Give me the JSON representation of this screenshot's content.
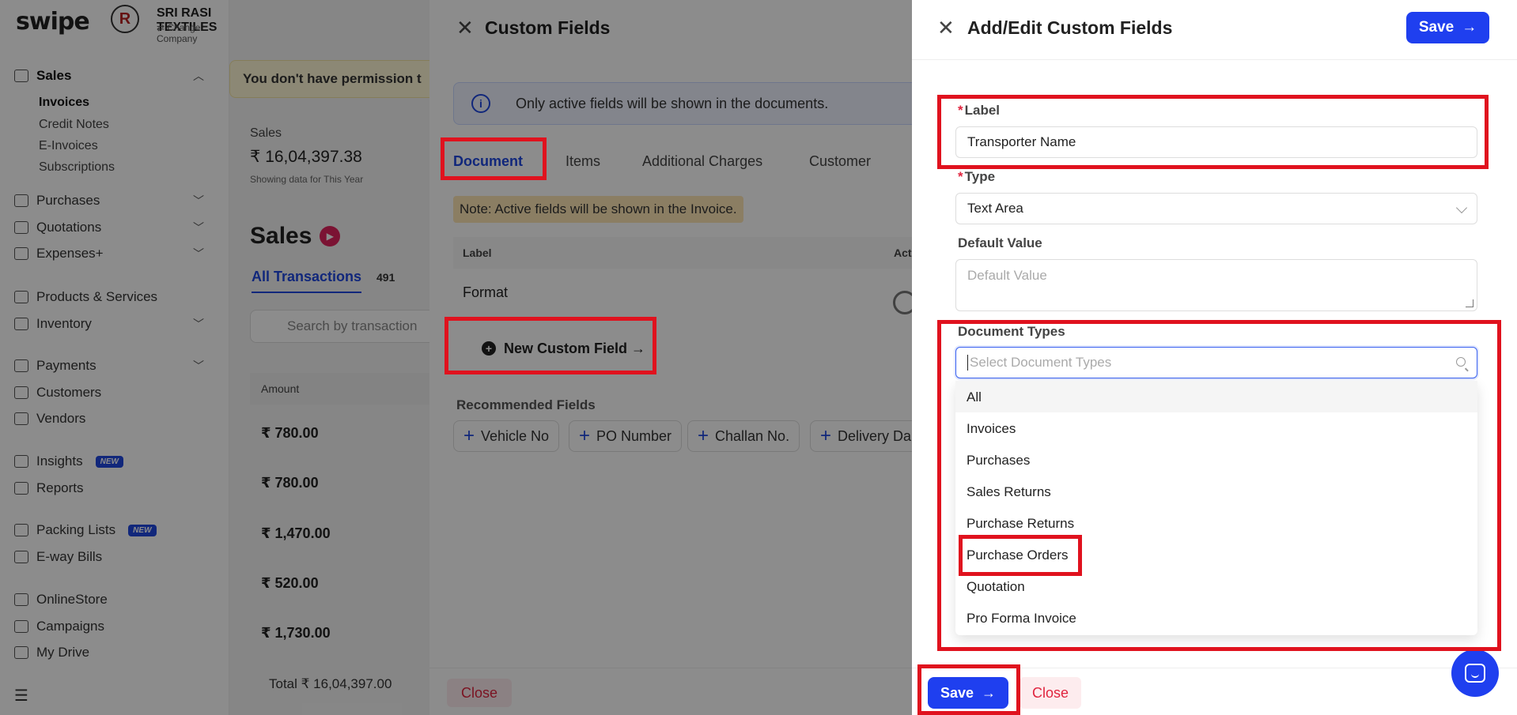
{
  "base": {
    "logo": "swipe",
    "company": {
      "name": "SRI RASI TEXTILES",
      "change": "Change Company",
      "logo_letter": "R"
    },
    "nav": {
      "sales": "Sales",
      "sales_sub": [
        "Invoices",
        "Credit Notes",
        "E-Invoices",
        "Subscriptions"
      ],
      "purchases": "Purchases",
      "quotations": "Quotations",
      "expenses": "Expenses+",
      "products": "Products & Services",
      "inventory": "Inventory",
      "payments": "Payments",
      "customers": "Customers",
      "vendors": "Vendors",
      "insights": "Insights",
      "reports": "Reports",
      "packing": "Packing Lists",
      "eway": "E-way Bills",
      "store": "OnlineStore",
      "campaigns": "Campaigns",
      "drive": "My Drive",
      "new_badge": "NEW"
    },
    "permission_banner": "You don't have permission t",
    "stat": {
      "label": "Sales",
      "value": "₹ 16,04,397.38",
      "note": "Showing data for This Year"
    },
    "page_title": "Sales",
    "tab_all": "All Transactions",
    "tab_count": "491",
    "search_placeholder": "Search by transaction",
    "column_amount": "Amount",
    "amounts": [
      "₹ 780.00",
      "₹ 780.00",
      "₹ 1,470.00",
      "₹ 520.00",
      "₹ 1,730.00"
    ],
    "total": "Total ₹ 16,04,397.00"
  },
  "custom_fields": {
    "title": "Custom Fields",
    "info": "Only active fields will be shown in the documents.",
    "tabs": [
      "Document",
      "Items",
      "Additional Charges",
      "Customer"
    ],
    "note": "Note: Active fields will be shown in the Invoice.",
    "col_label": "Label",
    "col_active": "Act",
    "row_format": "Format",
    "new_button": "New Custom Field →",
    "recommended_title": "Recommended Fields",
    "recommended": [
      "Vehicle No",
      "PO Number",
      "Challan No.",
      "Delivery Da"
    ],
    "close": "Close"
  },
  "add_edit": {
    "title": "Add/Edit Custom Fields",
    "save": "Save",
    "label_label": "Label",
    "label_value": "Transporter Name",
    "type_label": "Type",
    "type_value": "Text Area",
    "default_label": "Default Value",
    "default_placeholder": "Default Value",
    "doc_types_label": "Document Types",
    "doc_types_placeholder": "Select Document Types",
    "doc_types_options": [
      "All",
      "Invoices",
      "Purchases",
      "Sales Returns",
      "Purchase Returns",
      "Purchase Orders",
      "Quotation",
      "Pro Forma Invoice"
    ],
    "close": "Close"
  },
  "colors": {
    "primary": "#1f3fef",
    "danger": "#e0243e",
    "highlight": "#e0121e"
  }
}
